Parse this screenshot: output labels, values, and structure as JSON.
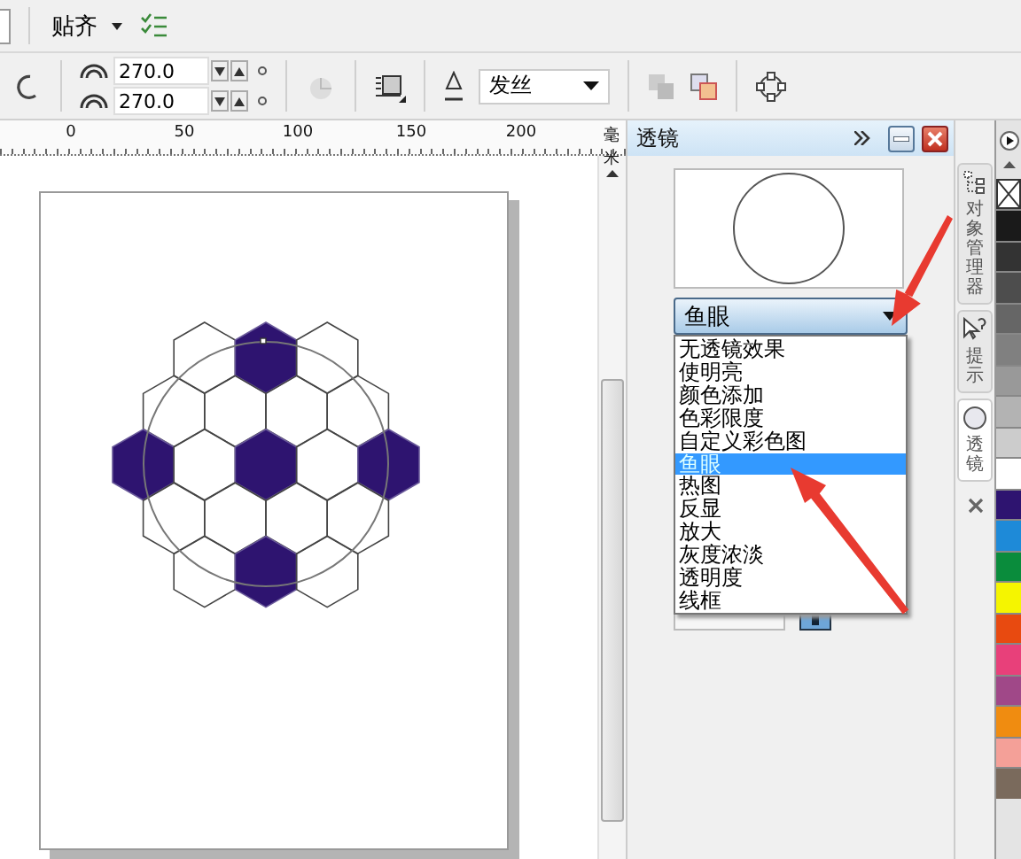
{
  "toolbar_top": {
    "snap_label": "贴齐"
  },
  "toolbar": {
    "angle_fields": [
      {
        "value": "270.0"
      },
      {
        "value": "270.0"
      }
    ],
    "outline_dropdown": {
      "value": "发丝"
    }
  },
  "ruler": {
    "labels": [
      "0",
      "50",
      "100",
      "150",
      "200"
    ],
    "unit": "毫米"
  },
  "drawing": {
    "rows": [
      {
        "cells": [
          {
            "filled": false
          },
          {
            "filled": true
          },
          {
            "filled": false
          }
        ]
      },
      {
        "cells": [
          {
            "filled": false
          },
          {
            "filled": false
          },
          {
            "filled": false
          },
          {
            "filled": false
          }
        ]
      },
      {
        "cells": [
          {
            "filled": true
          },
          {
            "filled": false
          },
          {
            "filled": true
          },
          {
            "filled": false
          },
          {
            "filled": true
          }
        ]
      },
      {
        "cells": [
          {
            "filled": false
          },
          {
            "filled": false
          },
          {
            "filled": false
          },
          {
            "filled": false
          }
        ]
      },
      {
        "cells": [
          {
            "filled": false
          },
          {
            "filled": true
          },
          {
            "filled": false
          }
        ]
      }
    ]
  },
  "docker": {
    "title": "透镜",
    "lens_dropdown": {
      "value": "鱼眼"
    },
    "lens_options": [
      {
        "label": "无透镜效果",
        "selected": false
      },
      {
        "label": "使明亮",
        "selected": false
      },
      {
        "label": "颜色添加",
        "selected": false
      },
      {
        "label": "色彩限度",
        "selected": false
      },
      {
        "label": "自定义彩色图",
        "selected": false
      },
      {
        "label": "鱼眼",
        "selected": true
      },
      {
        "label": "热图",
        "selected": false
      },
      {
        "label": "反显",
        "selected": false
      },
      {
        "label": "放大",
        "selected": false
      },
      {
        "label": "灰度浓淡",
        "selected": false
      },
      {
        "label": "透明度",
        "selected": false
      },
      {
        "label": "线框",
        "selected": false
      }
    ]
  },
  "side_tabs": [
    {
      "label": "对象管理器",
      "kind": "objects",
      "selected": false
    },
    {
      "label": "提示",
      "kind": "hints",
      "selected": false
    },
    {
      "label": "透镜",
      "kind": "lens",
      "selected": true
    }
  ],
  "palette": {
    "swatches": [
      {
        "color": "#1a1a1a"
      },
      {
        "color": "#333333"
      },
      {
        "color": "#4d4d4d"
      },
      {
        "color": "#666666"
      },
      {
        "color": "#808080"
      },
      {
        "color": "#999999"
      },
      {
        "color": "#b3b3b3"
      },
      {
        "color": "#cccccc"
      },
      {
        "color": "#ffffff"
      },
      {
        "color": "#2e1470"
      },
      {
        "color": "#1e8ad8"
      },
      {
        "color": "#0a8c3c"
      },
      {
        "color": "#f5f500"
      },
      {
        "color": "#e84a10"
      },
      {
        "color": "#e8407a"
      },
      {
        "color": "#a04888"
      },
      {
        "color": "#f08c10"
      },
      {
        "color": "#f4a098"
      },
      {
        "color": "#7a6a5c"
      }
    ]
  }
}
